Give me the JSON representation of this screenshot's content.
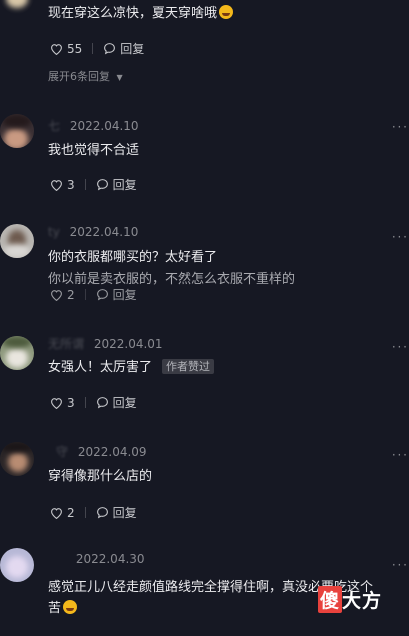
{
  "top_comment": {
    "text": "现在穿这么凉快，夏天穿啥哦",
    "emoji": "grinning-squint-tears-emoji",
    "likes": "55",
    "reply_label": "回复",
    "expand_label": "展开6条回复"
  },
  "comments": [
    {
      "name": "七",
      "date": "2022.04.10",
      "text": "我也觉得不合适",
      "likes": "3",
      "reply_label": "回复"
    },
    {
      "name": "ty",
      "date": "2022.04.10",
      "text": "你的衣服都哪买的？太好看了",
      "text2": "你以前是卖衣服的，不然怎么衣服不重样的",
      "likes": "2",
      "reply_label": "回复"
    },
    {
      "name": "无所谓",
      "date": "2022.04.01",
      "text": "女强人！太厉害了",
      "badge": "作者赞过",
      "likes": "3",
      "reply_label": "回复"
    },
    {
      "name": "守",
      "date": "2022.04.09",
      "text": "穿得像那什么店的",
      "likes": "2",
      "reply_label": "回复"
    },
    {
      "name": "",
      "date": "2022.04.30",
      "text": "感觉正儿八经走颜值路线完全撑得住啊，真没必要吃这个",
      "text2": "苦"
    }
  ],
  "more_icon": "more-dots-icon",
  "watermark": {
    "text": "傻大方",
    "box_char": "傻",
    "rest": "大方",
    "color": "#e8423d"
  }
}
